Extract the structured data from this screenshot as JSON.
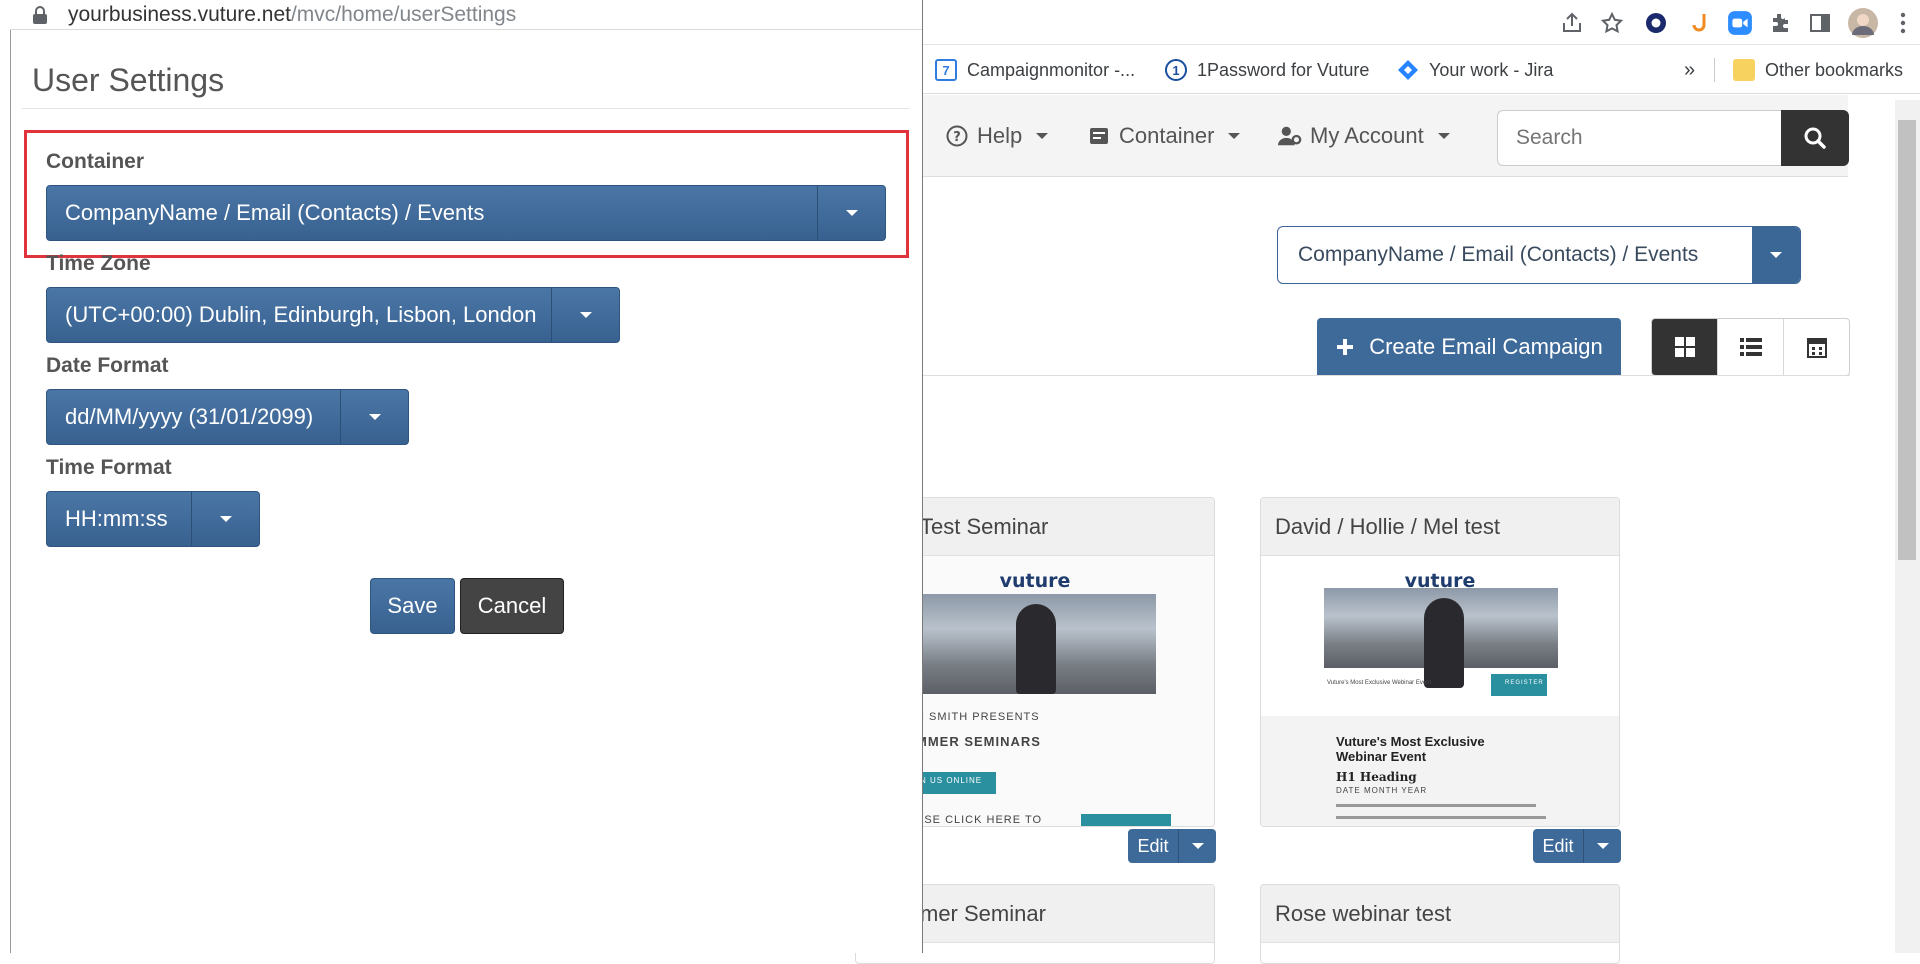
{
  "popup": {
    "url_host": "yourbusiness.vuture.net",
    "url_path": "/mvc/home/userSettings",
    "title": "User Settings",
    "fields": {
      "container": {
        "label": "Container",
        "value": "CompanyName / Email (Contacts) / Events"
      },
      "timezone": {
        "label": "Time Zone",
        "value": "(UTC+00:00) Dublin, Edinburgh, Lisbon, London"
      },
      "date_format": {
        "label": "Date Format",
        "value": "dd/MM/yyyy (31/01/2099)"
      },
      "time_format": {
        "label": "Time Format",
        "value": "HH:mm:ss"
      }
    },
    "save_label": "Save",
    "cancel_label": "Cancel",
    "highlight_color": "#e0333c"
  },
  "bookmarks": {
    "items": [
      {
        "label": "Campaignmonitor -...",
        "icon": "calendar-icon"
      },
      {
        "label": "1Password for Vuture",
        "icon": "1password-icon"
      },
      {
        "label": "Your work - Jira",
        "icon": "jira-icon"
      }
    ],
    "overflow": "»",
    "other": "Other bookmarks"
  },
  "nav": {
    "help": "Help",
    "container": "Container",
    "account": "My Account",
    "search_placeholder": "Search"
  },
  "main": {
    "container_select": "CompanyName / Email (Contacts) / Events",
    "create_campaign": "Create Email Campaign",
    "cards": [
      {
        "title": "Test Seminar",
        "edit": "Edit"
      },
      {
        "title": "David / Hollie / Mel test",
        "edit": "Edit"
      },
      {
        "title": "mer Seminar"
      },
      {
        "title": "Rose webinar test"
      }
    ],
    "thumb": {
      "logo": "vuture",
      "c1_line1": "N SMITH PRESENTS",
      "c1_line2": "MMER SEMINARS",
      "c1_button": "N US ONLINE",
      "c1_line3": "ASE CLICK HERE TO",
      "c2_event": "Vuture's Most Exclusive Webinar Event",
      "c2_register": "REGISTER",
      "c2_heading": "Vuture's Most Exclusive Webinar Event",
      "c2_h1": "H1 Heading",
      "c2_date": "DATE MONTH YEAR"
    }
  },
  "colors": {
    "primary": "#3e6a9a",
    "dark": "#333333",
    "highlight": "#e0333c"
  }
}
